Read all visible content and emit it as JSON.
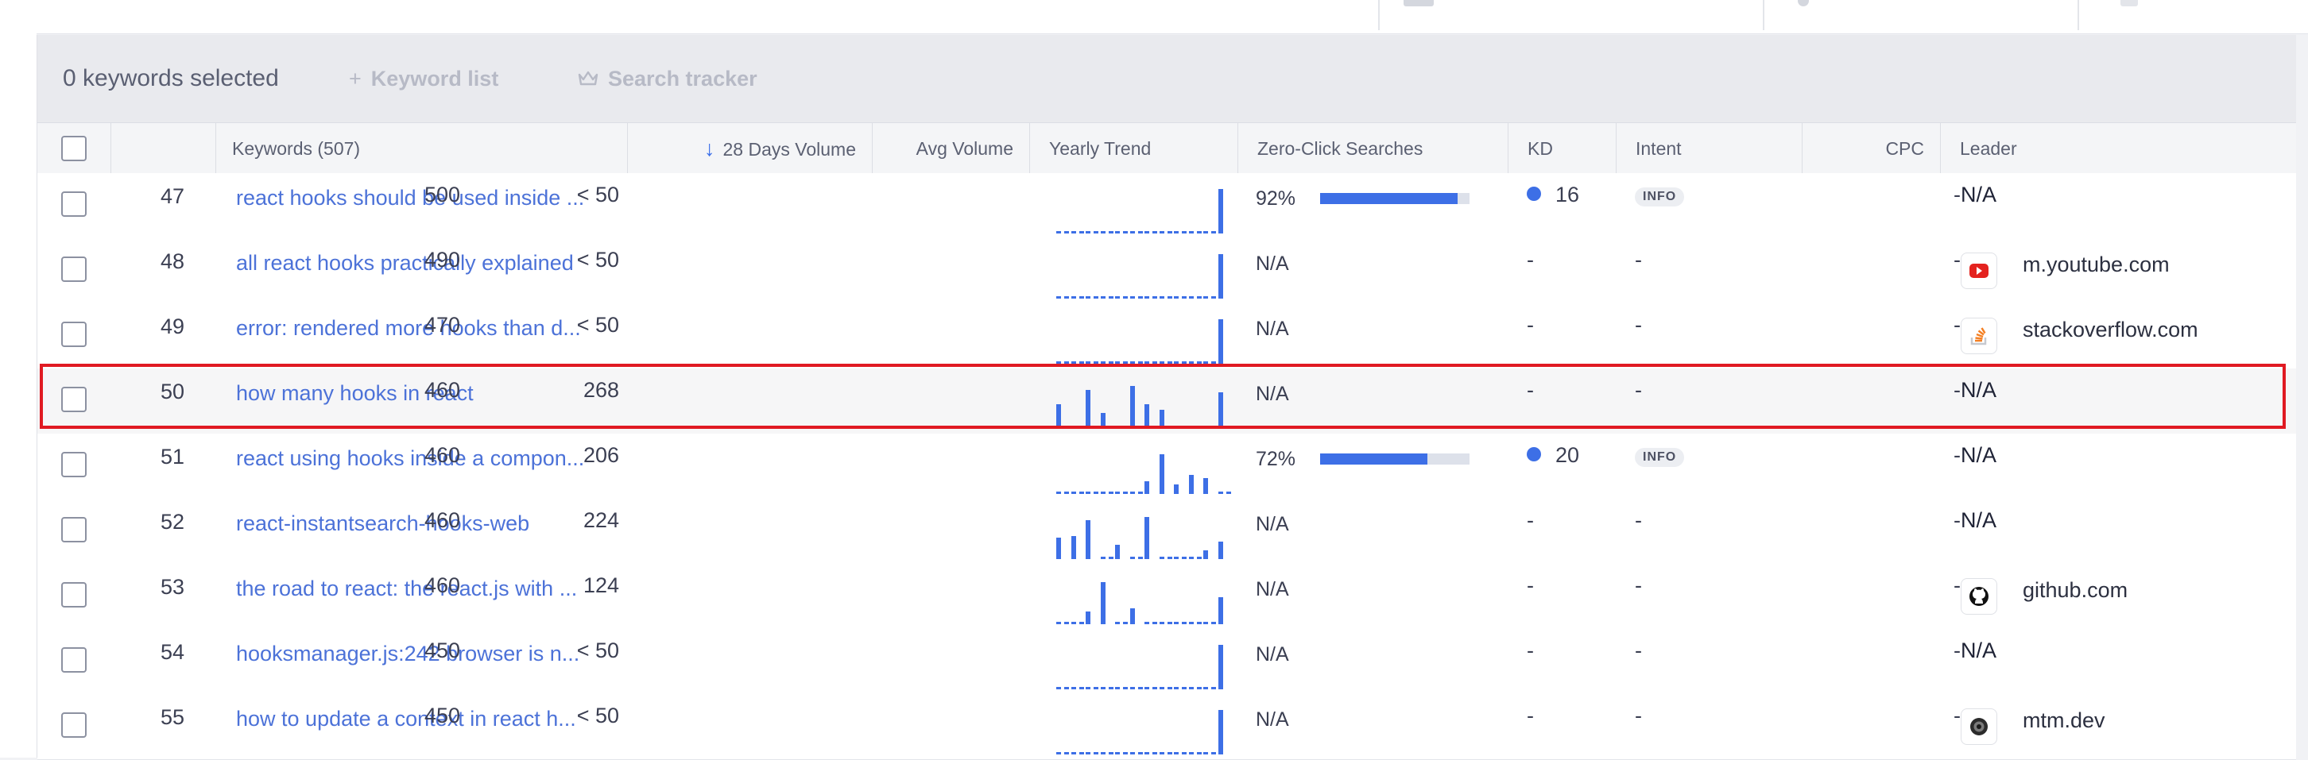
{
  "toolbar": {
    "selected_count": "0 keywords selected",
    "keyword_list_label": "Keyword list",
    "keyword_list_icon": "plus-icon",
    "search_tracker_label": "Search tracker",
    "search_tracker_icon": "crown-icon"
  },
  "columns": {
    "keywords": "Keywords (507)",
    "volume_28": "28 Days Volume",
    "avg_volume": "Avg Volume",
    "yearly_trend": "Yearly Trend",
    "zero_click": "Zero-Click Searches",
    "kd": "KD",
    "intent": "Intent",
    "cpc": "CPC",
    "leader": "Leader"
  },
  "colors": {
    "accent": "#3d6fe6",
    "link": "#4c72d8",
    "highlight_border": "#e01a22"
  },
  "rows": [
    {
      "num": "47",
      "keyword": "react hooks should be used inside ...",
      "volume": "500",
      "avg": "< 50",
      "trend": [
        0,
        0,
        0,
        0,
        0,
        0,
        0,
        0,
        0,
        0,
        0,
        1
      ],
      "zero_click": "92%",
      "zero_click_fraction": 0.92,
      "kd": "16",
      "intent": "INFO",
      "cpc": "-",
      "leader": "N/A",
      "leader_icon": ""
    },
    {
      "num": "48",
      "keyword": "all react hooks practically explained",
      "volume": "490",
      "avg": "< 50",
      "trend": [
        0,
        0,
        0,
        0,
        0,
        0,
        0,
        0,
        0,
        0,
        0,
        1
      ],
      "zero_click": "N/A",
      "kd": "-",
      "intent": "-",
      "cpc": "-",
      "leader": "m.youtube.com",
      "leader_icon": "youtube-icon"
    },
    {
      "num": "49",
      "keyword": "error: rendered more hooks than d...",
      "volume": "470",
      "avg": "< 50",
      "trend": [
        0,
        0,
        0,
        0,
        0,
        0,
        0,
        0,
        0,
        0,
        0,
        1
      ],
      "zero_click": "N/A",
      "kd": "-",
      "intent": "-",
      "cpc": "-",
      "leader": "stackoverflow.com",
      "leader_icon": "stackoverflow-icon"
    },
    {
      "num": "50",
      "keyword": "how many hooks in react",
      "volume": "460",
      "avg": "268",
      "trend": [
        0.55,
        0,
        0.88,
        0.35,
        0,
        0.96,
        0.55,
        0.42,
        0,
        0,
        0,
        0.82
      ],
      "zero_click": "N/A",
      "kd": "-",
      "intent": "-",
      "cpc": "-",
      "leader": "N/A",
      "leader_icon": "",
      "highlighted": true
    },
    {
      "num": "51",
      "keyword": "react using hooks inside a compon...",
      "volume": "460",
      "avg": "206",
      "trend": [
        0,
        0,
        0,
        0,
        0,
        0,
        0.28,
        0.9,
        0.22,
        0.42,
        0.36,
        0
      ],
      "zero_click": "72%",
      "zero_click_fraction": 0.72,
      "kd": "20",
      "intent": "INFO",
      "cpc": "-",
      "leader": "N/A",
      "leader_icon": ""
    },
    {
      "num": "52",
      "keyword": "react-instantsearch-hooks-web",
      "volume": "460",
      "avg": "224",
      "trend": [
        0.48,
        0.52,
        0.88,
        0,
        0.32,
        0,
        0.95,
        0,
        0,
        0,
        0.2,
        0.4
      ],
      "zero_click": "N/A",
      "kd": "-",
      "intent": "-",
      "cpc": "-",
      "leader": "N/A",
      "leader_icon": ""
    },
    {
      "num": "53",
      "keyword": "the road to react: the react.js with ...",
      "volume": "460",
      "avg": "124",
      "trend": [
        0,
        0,
        0.28,
        0.95,
        0,
        0.36,
        0,
        0,
        0,
        0,
        0,
        0.6
      ],
      "zero_click": "N/A",
      "kd": "-",
      "intent": "-",
      "cpc": "-",
      "leader": "github.com",
      "leader_icon": "github-icon"
    },
    {
      "num": "54",
      "keyword": "hooksmanager.js:242 browser is n...",
      "volume": "450",
      "avg": "< 50",
      "trend": [
        0,
        0,
        0,
        0,
        0,
        0,
        0,
        0,
        0,
        0,
        0,
        1
      ],
      "zero_click": "N/A",
      "kd": "-",
      "intent": "-",
      "cpc": "-",
      "leader": "N/A",
      "leader_icon": ""
    },
    {
      "num": "55",
      "keyword": "how to update a context in react h...",
      "volume": "450",
      "avg": "< 50",
      "trend": [
        0,
        0,
        0,
        0,
        0,
        0,
        0,
        0,
        0,
        0,
        0,
        1
      ],
      "zero_click": "N/A",
      "kd": "-",
      "intent": "-",
      "cpc": "-",
      "leader": "mtm.dev",
      "leader_icon": "mtm-icon"
    }
  ]
}
